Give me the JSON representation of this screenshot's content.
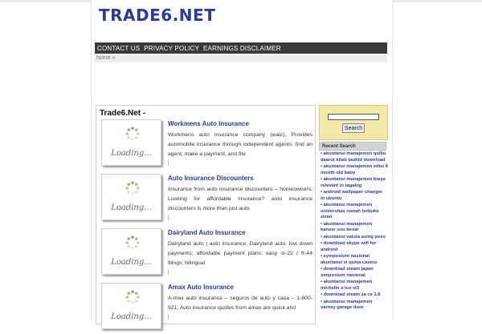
{
  "site": {
    "title": "TRADE6.NET"
  },
  "nav": {
    "items": [
      "CONTACT US",
      "PRIVACY POLICY",
      "EARNINGS DISCLAIMER"
    ]
  },
  "breadcrumb": "home »",
  "content": {
    "title": "Trade6.Net -",
    "loading_label": "Loading...",
    "posts": [
      {
        "title": "Workmens Auto Insurance",
        "excerpt": "Workmens auto insurance company (waic), Provides automobile insurance through independent agents. find an agent, make a payment, and file",
        "pipe": "|"
      },
      {
        "title": "Auto Insurance Discounters",
        "excerpt": "Insurance from auto insurance discounters – homeowners, Looking for affordable insurance? auto insurance discounters is more than just auto",
        "pipe": "|"
      },
      {
        "title": "Dairyland Auto Insurance",
        "excerpt": "Dairyland auto | auto insurance, Dairyland auto. low down payments; affordable payment plans; easy sr-22 / fr-44 filings; bilingual",
        "pipe": "|"
      },
      {
        "title": "Amax Auto Insurance",
        "excerpt": "A-max auto insurance – seguros de auto y casa – 1-800-921, Auto insurance quotes from amax are quick and",
        "pipe": "|"
      }
    ]
  },
  "sidebar": {
    "search_button": "Search",
    "search_value": "",
    "recent_title": "Recent Search",
    "recent_items": [
      "akuntansi manajemen qolbu daarut kitab tauhid download",
      "akuntansi manajemen edisi 8 month old baby",
      "akuntansi manajemen biaya relevant in tagalog",
      "android wallpaper changer in ubuntu",
      "akuntansi manajemen universitas rumah terbuka zizan",
      "akuntansi manajemen kanser usu besar",
      "akuntansi valuta asing peso",
      "download skype wifi for android",
      "symposium nasional akuntansi vi quiva casino",
      "download steam japan simposium nasional",
      "akuntansi manajemen michelin x-ice xi3",
      "download steam za cs 1.6",
      "akuntansi manajemen varney garage door"
    ]
  },
  "colors": {
    "accent": "#2b3a9b",
    "nav_bg": "#3a3a3a",
    "search_box_bg": "#f3e9a8"
  }
}
